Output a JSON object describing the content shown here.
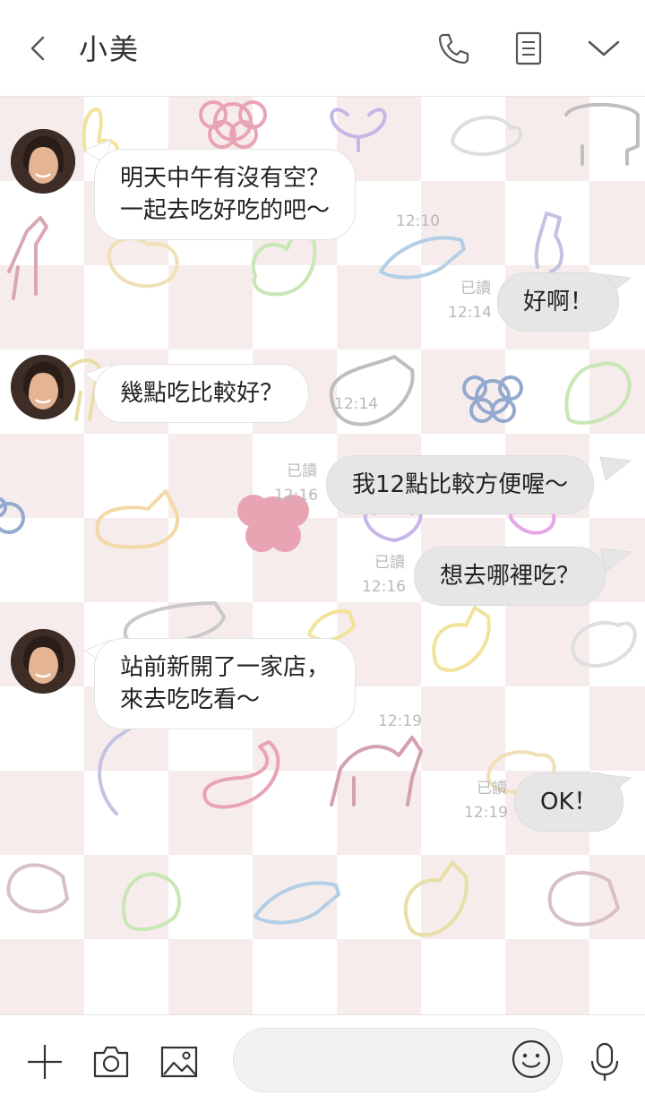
{
  "header": {
    "contact_name": "小美",
    "icons": [
      "back-arrow-icon",
      "phone-icon",
      "notes-icon",
      "chevron-down-icon"
    ]
  },
  "messages": [
    {
      "side": "in",
      "lines": [
        "明天中午有沒有空？",
        "一起去吃好吃的吧～"
      ],
      "time": "12:10"
    },
    {
      "side": "out",
      "lines": [
        "好啊！"
      ],
      "read": "已讀",
      "time": "12:14"
    },
    {
      "side": "in",
      "lines": [
        "幾點吃比較好？"
      ],
      "time": "12:14"
    },
    {
      "side": "out",
      "lines": [
        "我12點比較方便喔～"
      ],
      "read": "已讀",
      "time": "12:16"
    },
    {
      "side": "out",
      "lines": [
        "想去哪裡吃？"
      ],
      "read": "已讀",
      "time": "12:16"
    },
    {
      "side": "in",
      "lines": [
        "站前新開了一家店，",
        "來去吃吃看～"
      ],
      "time": "12:19"
    },
    {
      "side": "out",
      "lines": [
        "OK！"
      ],
      "read": "已讀",
      "time": "12:19"
    }
  ],
  "composer": {
    "placeholder": "",
    "icons": [
      "plus-icon",
      "camera-icon",
      "image-icon",
      "emoji-icon",
      "microphone-icon"
    ]
  },
  "colors": {
    "checker_pink": "#f7ecec",
    "bubble_out": "#e6e6e6",
    "bubble_in": "#ffffff",
    "meta_text": "#b9b9b9"
  }
}
